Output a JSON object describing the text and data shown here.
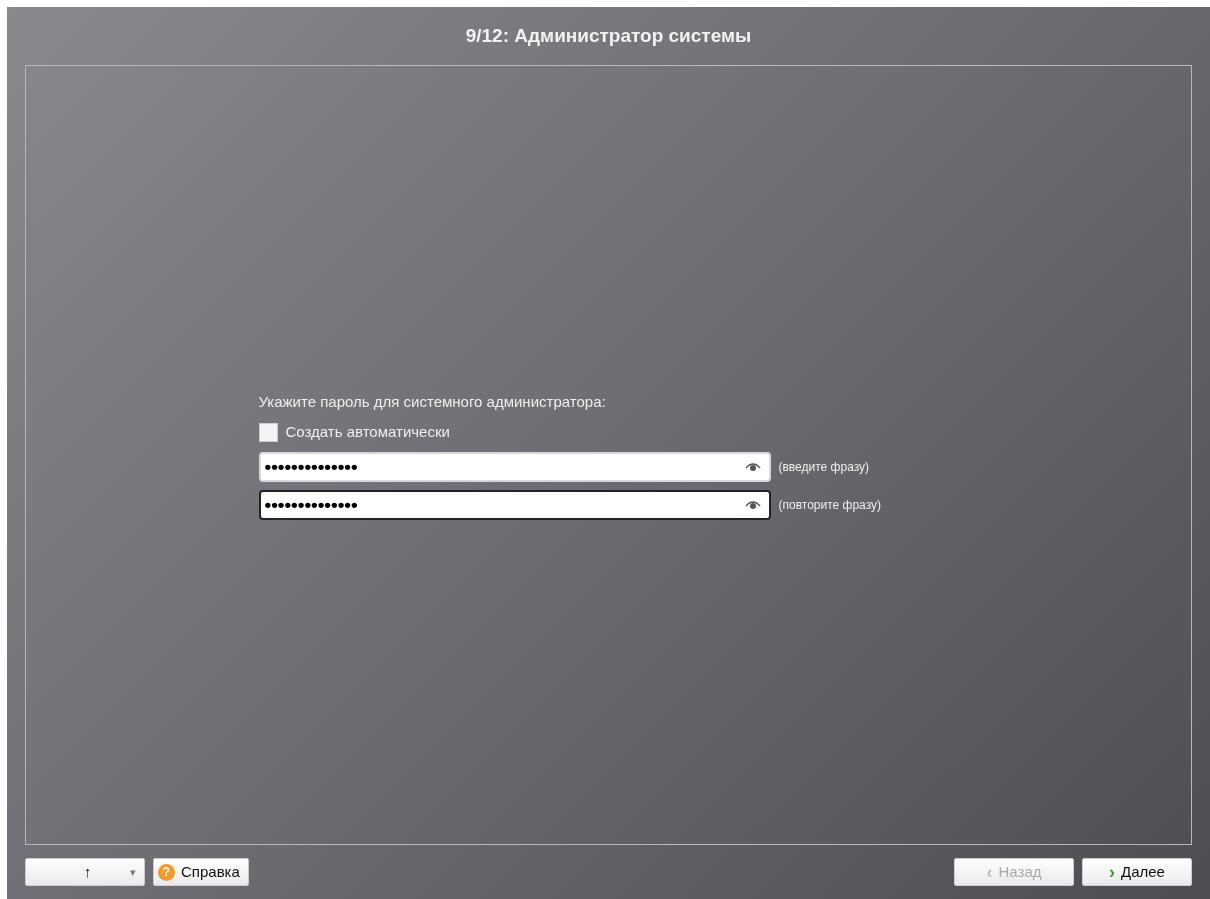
{
  "window": {
    "title": "9/12: Администратор системы"
  },
  "prompt": "Укажите пароль для системного администратора:",
  "auto_checkbox": {
    "label": "Создать автоматически",
    "checked": false
  },
  "password_fields": [
    {
      "value": "••••••••••••••",
      "hint": "(введите фразу)",
      "focused": false
    },
    {
      "value": "••••••••••••••",
      "hint": "(повторите фразу)",
      "focused": true
    }
  ],
  "footer": {
    "up_button": {
      "label": "↑",
      "caret": "▾"
    },
    "help_button": {
      "label": "Справка",
      "icon": "?"
    },
    "buttons": [
      {
        "label": "Назад",
        "arrow": "‹",
        "disabled": true
      },
      {
        "label": "Далее",
        "arrow": "›",
        "disabled": false
      }
    ]
  }
}
